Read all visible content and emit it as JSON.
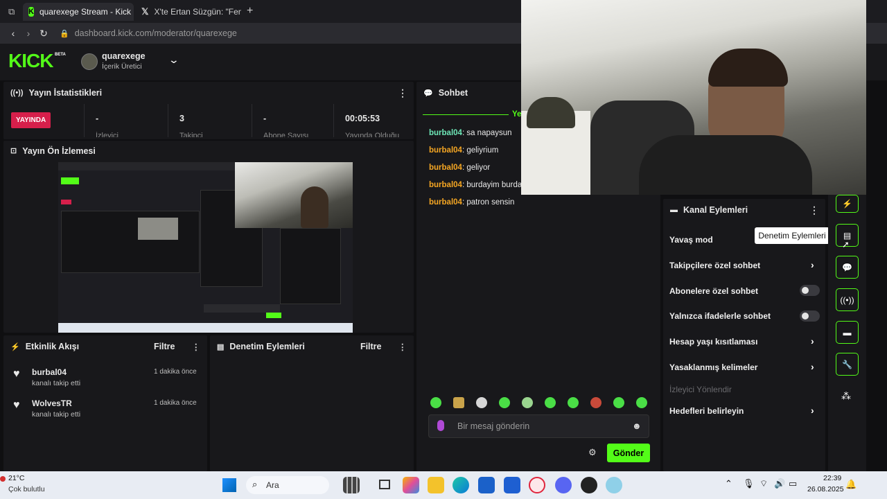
{
  "browser": {
    "tabs": [
      {
        "label": "quarexege Stream - Kick"
      },
      {
        "label": "X'te Ertan Süzgün: \"Fener"
      }
    ],
    "url_host": "dashboard.kick.com",
    "url_path": "/moderator/quarexege"
  },
  "kick": {
    "logo": "KICK",
    "beta": "BETA",
    "channel_name": "quarexege",
    "channel_role": "İçerik Üretici"
  },
  "stats": {
    "title": "Yayın İstatistikleri",
    "live_badge": "YAYINDA",
    "items": [
      {
        "value": "-",
        "label": "İzleyici"
      },
      {
        "value": "3",
        "label": "Takipçi"
      },
      {
        "value": "-",
        "label": "Abone Sayısı"
      },
      {
        "value": "00:05:53",
        "label": "Yayında Olduğu"
      }
    ]
  },
  "preview": {
    "title": "Yayın Ön İzlemesi"
  },
  "activity": {
    "title": "Etkinlik Akışı",
    "filter": "Filtre",
    "events": [
      {
        "user": "burbal04",
        "text": "kanalı takip etti",
        "time": "1 dakika önce"
      },
      {
        "user": "WolvesTR",
        "text": "kanalı takip etti",
        "time": "1 dakika önce"
      }
    ]
  },
  "modactions": {
    "title": "Denetim Eylemleri",
    "filter": "Filtre"
  },
  "chat": {
    "title": "Sohbet",
    "divider_label": "Ye",
    "messages": [
      {
        "user": "burbal04",
        "text": ": sa napaysun",
        "color": "#6ee7b7"
      },
      {
        "user": "burbal04",
        "text": ": geliyrium",
        "color": "#f5a623"
      },
      {
        "user": "burbal04",
        "text": ": geliyor",
        "color": "#f5a623"
      },
      {
        "user": "burbal04",
        "text": ": burdayim burda",
        "color": "#f5a623"
      },
      {
        "user": "burbal04",
        "text": ": patron sensin",
        "color": "#f5a623"
      }
    ],
    "input_placeholder": "Bir mesaj gönderin",
    "send_label": "Gönder"
  },
  "channel_actions": {
    "title": "Kanal Eylemleri",
    "tooltip": "Denetim Eylemleri",
    "items": [
      {
        "label": "Yavaş mod",
        "control": "none"
      },
      {
        "label": "Takipçilere özel sohbet",
        "control": "chevron"
      },
      {
        "label": "Abonelere özel sohbet",
        "control": "toggle"
      },
      {
        "label": "Yalnızca ifadelerle sohbet",
        "control": "toggle"
      },
      {
        "label": "Hesap yaşı kısıtlaması",
        "control": "chevron"
      },
      {
        "label": "Yasaklanmış kelimeler",
        "control": "chevron"
      },
      {
        "label": "İzleyici Yönlendir",
        "control": "disabled"
      },
      {
        "label": "Hedefleri belirleyin",
        "control": "chevron"
      }
    ]
  },
  "taskbar": {
    "weather_temp": "21°C",
    "weather_desc": "Çok bulutlu",
    "search_label": "Ara",
    "time": "22:39",
    "date": "26.08.2025"
  },
  "colors": {
    "accent": "#53fc18",
    "live": "#d61f4b",
    "panel": "#18181b"
  }
}
